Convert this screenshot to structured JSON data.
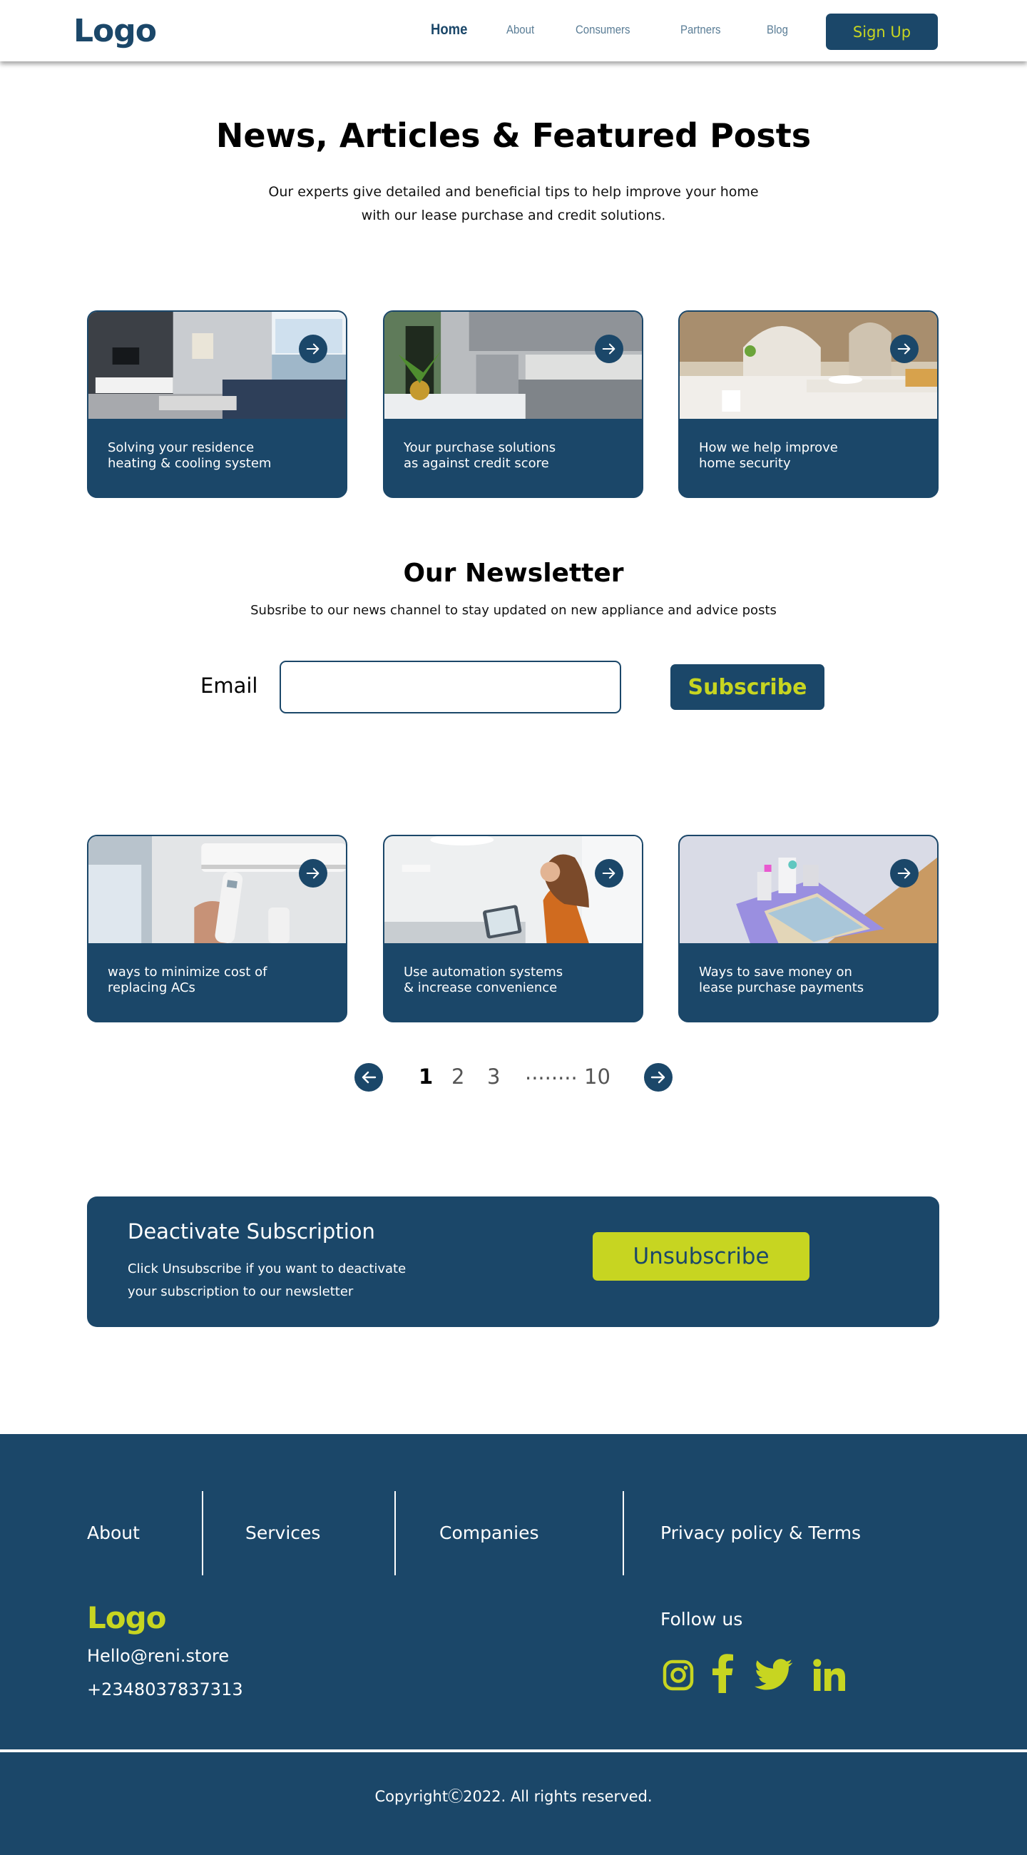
{
  "nav": {
    "logo": "Logo",
    "links": [
      "Home",
      "About",
      "Consumers",
      "Partners",
      "Blog"
    ],
    "signup_label": "Sign Up"
  },
  "hero": {
    "title": "News, Articles & Featured Posts",
    "subtitle": "Our experts give detailed and beneficial tips to help improve your home with our lease purchase and credit solutions."
  },
  "articles": [
    {
      "text": "Solving your residence\nheating & cooling system",
      "image": "living-room"
    },
    {
      "text": "Your purchase solutions\nas against credit score",
      "image": "kitchen"
    },
    {
      "text": "How we help improve\nhome security",
      "image": "bathroom"
    },
    {
      "text": "ways to minimize cost of\nreplacing ACs",
      "image": "ac-remote"
    },
    {
      "text": "Use automation systems\n& increase convenience",
      "image": "woman-tablet"
    },
    {
      "text": "Ways to save money on\nlease purchase payments",
      "image": "money-model"
    }
  ],
  "newsletter": {
    "title": "Our Newsletter",
    "subtitle": "Subsribe to our news channel to stay updated on new appliance and advice posts",
    "email_label": "Email",
    "email_value": "",
    "subscribe_label": "Subscribe"
  },
  "pagination": {
    "pages": [
      "1",
      "2",
      "3",
      "........",
      "10"
    ],
    "current": "1"
  },
  "deactivate": {
    "title": "Deactivate Subscription",
    "text": "Click Unsubscribe if you want to deactivate your subscription to our newsletter",
    "button_label": "Unsubscribe"
  },
  "footer": {
    "links": [
      "About",
      "Services",
      "Companies",
      "Privacy policy & Terms"
    ],
    "logo": "Logo",
    "email": "Hello@reni.store",
    "phone": "+2348037837313",
    "follow_label": "Follow us",
    "social": [
      "instagram-icon",
      "facebook-icon",
      "twitter-icon",
      "linkedin-icon"
    ],
    "copyright": "CopyrightⒸ2022.  All rights reserved."
  },
  "colors": {
    "primary": "#1b4769",
    "accent": "#c7d521"
  }
}
